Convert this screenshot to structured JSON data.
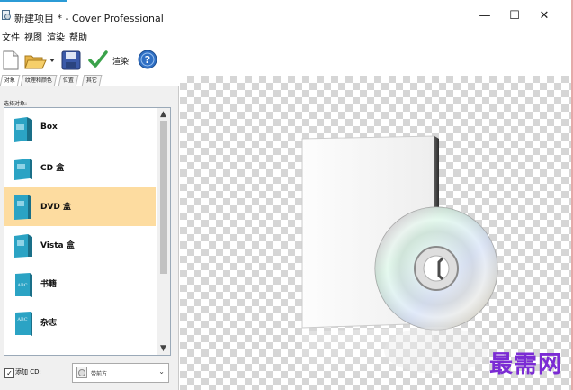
{
  "window": {
    "title": "新建项目 * - Cover Professional",
    "controls": {
      "minimize": "—",
      "maximize": "☐",
      "close": "✕"
    }
  },
  "menu": {
    "items": [
      "文件",
      "视图",
      "渲染",
      "帮助"
    ]
  },
  "toolbar": {
    "new_icon": "new-file-icon",
    "open_icon": "open-folder-icon",
    "save_icon": "save-icon",
    "render_label": "渲染",
    "help_icon": "help-icon"
  },
  "tabs": [
    {
      "label": "对象",
      "active": true
    },
    {
      "label": "纹理和颜色",
      "active": false
    },
    {
      "label": "位置",
      "active": false
    },
    {
      "label": "其它",
      "active": false
    }
  ],
  "panel": {
    "label": "选择对象:",
    "items": [
      {
        "label": "Box",
        "icon": "box-icon",
        "selected": false
      },
      {
        "label": "CD 盒",
        "icon": "cd-case-icon",
        "selected": false
      },
      {
        "label": "DVD 盒",
        "icon": "dvd-case-icon",
        "selected": true
      },
      {
        "label": "Vista 盒",
        "icon": "vista-box-icon",
        "selected": false
      },
      {
        "label": "书籍",
        "icon": "book-icon",
        "selected": false
      },
      {
        "label": "杂志",
        "icon": "magazine-icon",
        "selected": false
      }
    ],
    "add_cd_label": "添加 CD:",
    "add_cd_checked": true,
    "disc_dropdown_value": "带前方"
  },
  "watermark": "最需网",
  "colors": {
    "selection": "#fddca0",
    "accent": "#2b9bd6",
    "watermark": "#7b2bd4"
  }
}
